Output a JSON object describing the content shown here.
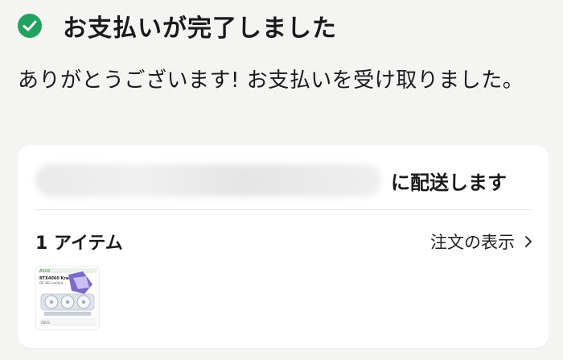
{
  "header": {
    "title": "お支払いが完了しました",
    "icon": "check-circle-icon"
  },
  "message": "ありがとうございます! お支払いを受け取りました。",
  "shipping": {
    "label": "に配送します"
  },
  "items": {
    "count_label": "1 アイテム",
    "view_order_label": "注文の表示"
  },
  "product": {
    "thumbnail_icon": "product-thumbnail",
    "label": "RTX4060 Kraft",
    "sub": "OC 8G Limited",
    "footer": "ASUS"
  },
  "colors": {
    "success": "#21a35f",
    "card": "#ffffff",
    "background": "#f4f4f2"
  }
}
